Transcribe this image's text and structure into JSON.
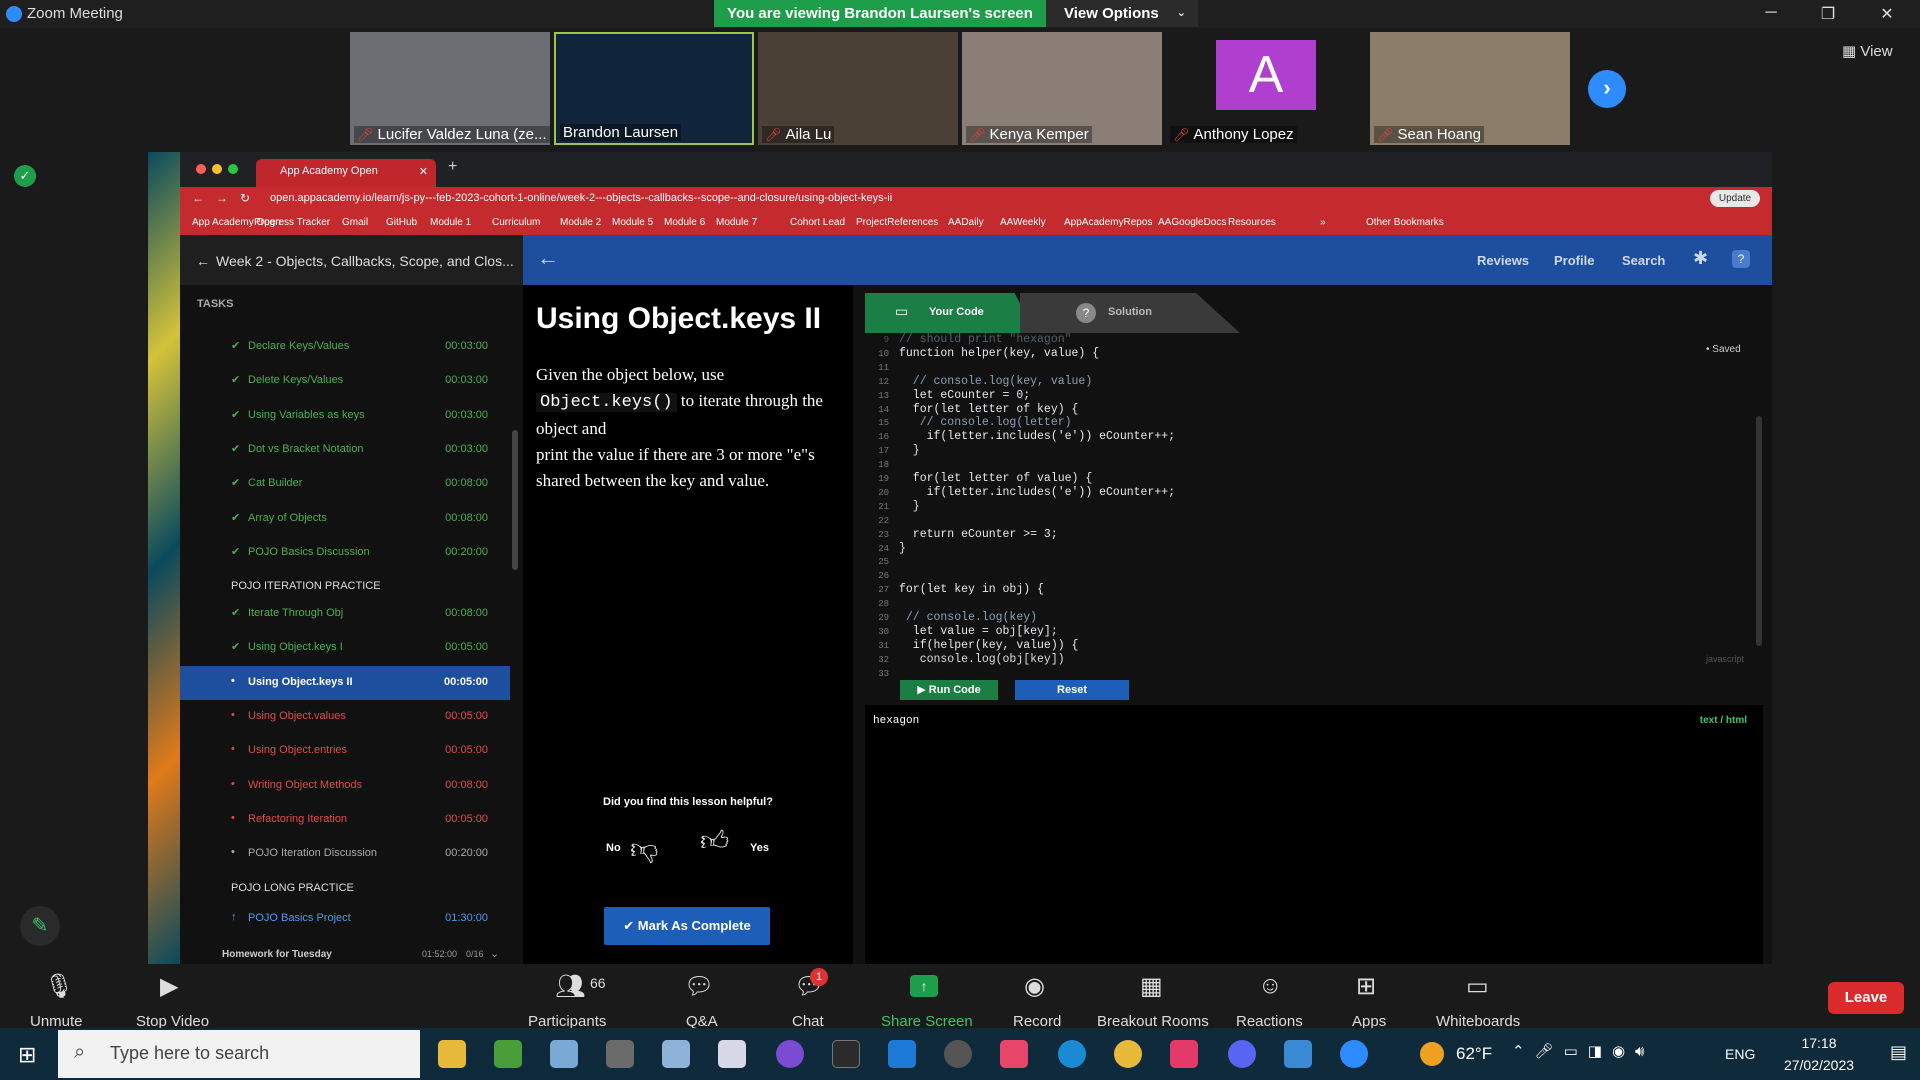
{
  "app": {
    "title": "Zoom Meeting",
    "share_banner": "You are viewing Brandon Laursen's screen",
    "view_options": "View Options",
    "view_label": "View"
  },
  "participants_gallery": [
    {
      "name": "Lucifer Valdez Luna (ze...",
      "muted": true
    },
    {
      "name": "Brandon Laursen",
      "muted": false
    },
    {
      "name": "Aila Lu",
      "muted": true
    },
    {
      "name": "Kenya Kemper",
      "muted": true
    },
    {
      "name": "Anthony Lopez",
      "muted": true,
      "avatar_letter": "A"
    },
    {
      "name": "Sean Hoang",
      "muted": true
    }
  ],
  "browser": {
    "tab_title": "App Academy Open",
    "url": "open.appacademy.io/learn/js-py---feb-2023-cohort-1-online/week-2---objects--callbacks--scope--and-closure/using-object-keys-ii",
    "update_label": "Update",
    "bookmarks": [
      "App Academy Open",
      "Progress Tracker",
      "Gmail",
      "GitHub",
      "Module 1",
      "Curriculum",
      "Module 2",
      "Module 5",
      "Module 6",
      "Module 7",
      "Cohort Lead",
      "ProjectReferences",
      "AADaily",
      "AAWeekly",
      "AppAcademyRepos",
      "AAGoogleDocs",
      "Resources",
      "»",
      "Other Bookmarks"
    ]
  },
  "sidebar": {
    "week_title": "Week 2 - Objects, Callbacks, Scope, and Clos...",
    "tasks_label": "TASKS",
    "tasks": [
      {
        "label": "Declare Keys/Values",
        "time": "00:03:00",
        "status": "done"
      },
      {
        "label": "Delete Keys/Values",
        "time": "00:03:00",
        "status": "done"
      },
      {
        "label": "Using Variables as keys",
        "time": "00:03:00",
        "status": "done"
      },
      {
        "label": "Dot vs Bracket Notation",
        "time": "00:03:00",
        "status": "done"
      },
      {
        "label": "Cat Builder",
        "time": "00:08:00",
        "status": "done"
      },
      {
        "label": "Array of Objects",
        "time": "00:08:00",
        "status": "done"
      },
      {
        "label": "POJO Basics Discussion",
        "time": "00:20:00",
        "status": "done"
      }
    ],
    "section_iteration": "POJO ITERATION PRACTICE",
    "iteration_tasks": [
      {
        "label": "Iterate Through Obj",
        "time": "00:08:00",
        "status": "done"
      },
      {
        "label": "Using Object.keys I",
        "time": "00:05:00",
        "status": "done"
      },
      {
        "label": "Using Object.keys II",
        "time": "00:05:00",
        "status": "active"
      },
      {
        "label": "Using Object.values",
        "time": "00:05:00",
        "status": "todo"
      },
      {
        "label": "Using Object.entries",
        "time": "00:05:00",
        "status": "todo"
      },
      {
        "label": "Writing Object Methods",
        "time": "00:08:00",
        "status": "todo"
      },
      {
        "label": "Refactoring Iteration",
        "time": "00:05:00",
        "status": "todo"
      },
      {
        "label": "POJO Iteration Discussion",
        "time": "00:20:00",
        "status": "plain"
      }
    ],
    "section_long": "POJO LONG PRACTICE",
    "long_tasks": [
      {
        "label": "POJO Basics Project",
        "time": "01:30:00",
        "status": "upload"
      }
    ],
    "homework": {
      "label": "Homework for Tuesday",
      "time": "01:52:00",
      "count": "0/16"
    }
  },
  "topnav": {
    "reviews": "Reviews",
    "profile": "Profile",
    "search": "Search",
    "help": "?"
  },
  "lesson": {
    "title": "Using Object.keys II",
    "body_1": "Given the object below, use",
    "body_code": "Object.keys()",
    "body_2": "to iterate through the object and",
    "body_3": "print the value if there are 3 or more \"e\"s shared between the key and value.",
    "feedback_q": "Did you find this lesson helpful?",
    "no": "No",
    "yes": "Yes",
    "complete_btn": "✔ Mark As Complete"
  },
  "editor": {
    "tab_your_code": "Your Code",
    "tab_solution": "Solution",
    "saved": "• Saved",
    "lang": "javascript",
    "run": "▶ Run Code",
    "reset": "Reset",
    "output_text": "hexagon",
    "output_type": "text / html",
    "lines": [
      {
        "n": "9",
        "t": "// should print \"hexagon\""
      },
      {
        "n": "10",
        "t": "function helper(key, value) {"
      },
      {
        "n": "11",
        "t": ""
      },
      {
        "n": "12",
        "t": "  // console.log(key, value)"
      },
      {
        "n": "13",
        "t": "  let eCounter = 0;"
      },
      {
        "n": "14",
        "t": "  for(let letter of key) {"
      },
      {
        "n": "15",
        "t": "   // console.log(letter)"
      },
      {
        "n": "16",
        "t": "    if(letter.includes('e')) eCounter++;"
      },
      {
        "n": "17",
        "t": "  }"
      },
      {
        "n": "18",
        "t": ""
      },
      {
        "n": "19",
        "t": "  for(let letter of value) {"
      },
      {
        "n": "20",
        "t": "    if(letter.includes('e')) eCounter++;"
      },
      {
        "n": "21",
        "t": "  }"
      },
      {
        "n": "22",
        "t": ""
      },
      {
        "n": "23",
        "t": "  return eCounter >= 3;"
      },
      {
        "n": "24",
        "t": "}"
      },
      {
        "n": "25",
        "t": ""
      },
      {
        "n": "26",
        "t": ""
      },
      {
        "n": "27",
        "t": "for(let key in obj) {"
      },
      {
        "n": "28",
        "t": ""
      },
      {
        "n": "29",
        "t": " // console.log(key)"
      },
      {
        "n": "30",
        "t": "  let value = obj[key];"
      },
      {
        "n": "31",
        "t": "  if(helper(key, value)) {"
      },
      {
        "n": "32",
        "t": "   console.log(obj[key])"
      },
      {
        "n": "33",
        "t": ""
      }
    ]
  },
  "zoom_toolbar": {
    "unmute": "Unmute",
    "stop_video": "Stop Video",
    "participants": "Participants",
    "participants_count": "66",
    "qa": "Q&A",
    "chat": "Chat",
    "chat_badge": "1",
    "share_screen": "Share Screen",
    "record": "Record",
    "breakout": "Breakout Rooms",
    "reactions": "Reactions",
    "apps": "Apps",
    "whiteboards": "Whiteboards",
    "leave": "Leave"
  },
  "taskbar": {
    "search_placeholder": "Type here to search",
    "temp": "62°F",
    "lang": "ENG",
    "time": "17:18",
    "date": "27/02/2023"
  },
  "colors": {
    "zoom_blue": "#2d8cff",
    "share_green": "#1e9e4a",
    "aa_red": "#c42a2e",
    "aa_blue": "#1d4f9e",
    "done_green": "#4caf50",
    "todo_red": "#e04b4b",
    "leave_red": "#d92b2b"
  }
}
